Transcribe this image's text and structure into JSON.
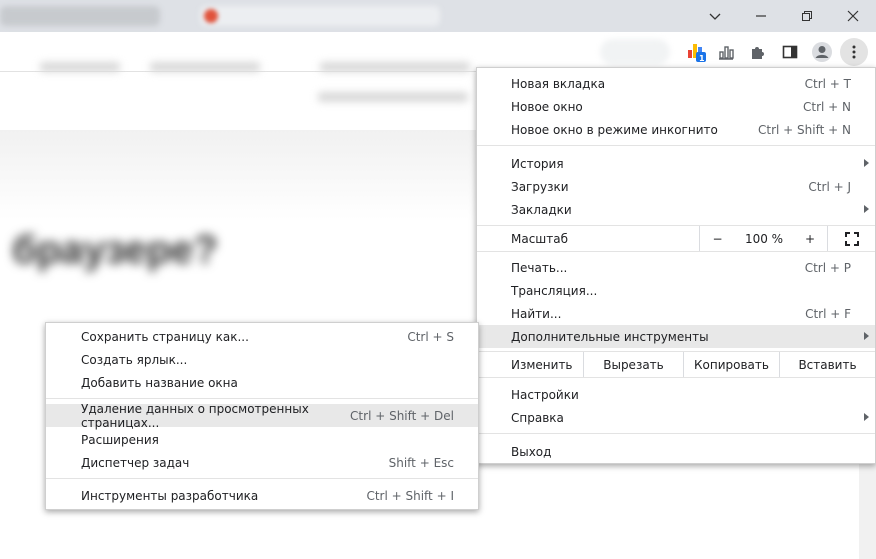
{
  "profile_menu": {
    "new_tab": {
      "label": "Новая вкладка",
      "shortcut": "Ctrl + T"
    },
    "new_window": {
      "label": "Новое окно",
      "shortcut": "Ctrl + N"
    },
    "incognito": {
      "label": "Новое окно в режиме инкогнито",
      "shortcut": "Ctrl + Shift + N"
    },
    "history": {
      "label": "История"
    },
    "downloads": {
      "label": "Загрузки",
      "shortcut": "Ctrl + J"
    },
    "bookmarks": {
      "label": "Закладки"
    },
    "zoom": {
      "label": "Масштаб",
      "minus": "−",
      "value": "100 %",
      "plus": "+"
    },
    "print": {
      "label": "Печать...",
      "shortcut": "Ctrl + P"
    },
    "cast": {
      "label": "Трансляция..."
    },
    "find": {
      "label": "Найти...",
      "shortcut": "Ctrl + F"
    },
    "more_tools": {
      "label": "Дополнительные инструменты"
    },
    "edit": {
      "label": "Изменить",
      "cut": "Вырезать",
      "copy": "Копировать",
      "paste": "Вставить"
    },
    "settings": {
      "label": "Настройки"
    },
    "help": {
      "label": "Справка"
    },
    "exit": {
      "label": "Выход"
    }
  },
  "more_tools_menu": {
    "save_page": {
      "label": "Сохранить страницу как...",
      "shortcut": "Ctrl + S"
    },
    "create_shortcut": {
      "label": "Создать ярлык..."
    },
    "name_window": {
      "label": "Добавить название окна"
    },
    "clear_data": {
      "label": "Удаление данных о просмотренных страницах...",
      "shortcut": "Ctrl + Shift + Del"
    },
    "extensions": {
      "label": "Расширения"
    },
    "task_manager": {
      "label": "Диспетчер задач",
      "shortcut": "Shift + Esc"
    },
    "dev_tools": {
      "label": "Инструменты разработчика",
      "shortcut": "Ctrl + Shift + I"
    }
  },
  "toolbar": {
    "extension_badge": "1"
  },
  "page": {
    "blurred_heading": "браузере?"
  },
  "colors": {
    "highlight": "#e8e8e8",
    "chrome_bg": "#dee1e6",
    "badge": "#1a73e8"
  },
  "icons": [
    "chevron-down-icon",
    "minimize-icon",
    "restore-icon",
    "close-icon",
    "extension-stats-icon",
    "bar-chart-icon",
    "puzzle-icon",
    "side-panel-icon",
    "profile-icon",
    "more-vert-icon",
    "fullscreen-icon",
    "submenu-arrow-icon"
  ]
}
